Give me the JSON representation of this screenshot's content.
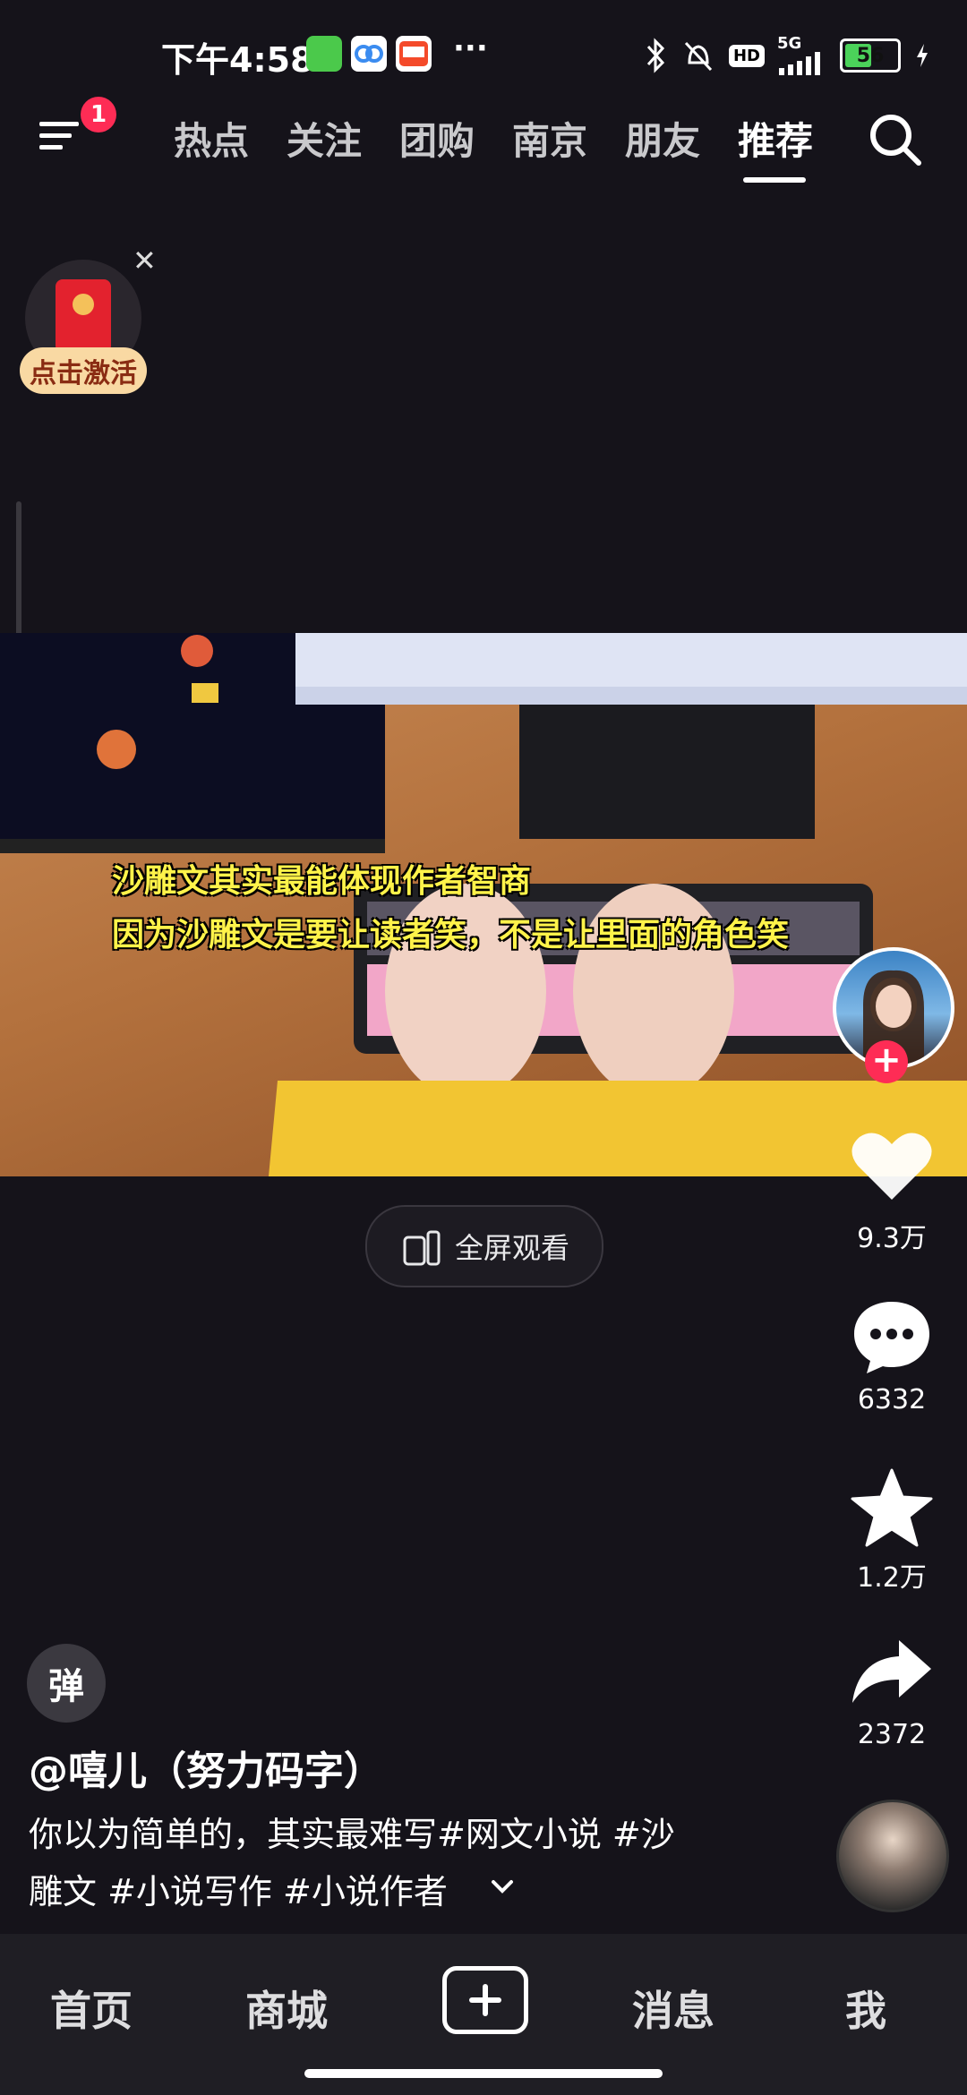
{
  "status_bar": {
    "time": "下午4:58",
    "network": "5G",
    "battery": "56",
    "battery_level": 0.56,
    "icons": [
      "app-green-icon",
      "app-blue-icon",
      "app-58-icon",
      "more-dots-icon",
      "bluetooth-icon",
      "mute-bell-icon",
      "hd-icon",
      "signal-icon",
      "charging-icon"
    ]
  },
  "top_nav": {
    "menu_badge": "1",
    "tabs": [
      "热点",
      "关注",
      "团购",
      "南京",
      "朋友",
      "推荐"
    ],
    "active_tab": "推荐"
  },
  "red_packet": {
    "label": "点击激活"
  },
  "video": {
    "subtitle_line1": "沙雕文其实最能体现作者智商",
    "subtitle_line2": "因为沙雕文是要让读者笑，不是让里面的角色笑",
    "fullscreen_label": "全屏观看"
  },
  "actions": {
    "likes": "9.3万",
    "comments": "6332",
    "favorites": "1.2万",
    "shares": "2372"
  },
  "post": {
    "danmu_label": "弹",
    "username": "@嘻儿（努力码字）",
    "desc_line1": "你以为简单的，其实最难写#网文小说 #沙",
    "desc_line2": "雕文 #小说写作 #小说作者"
  },
  "bottom_nav": {
    "home": "首页",
    "mall": "商城",
    "messages": "消息",
    "me": "我"
  },
  "colors": {
    "background": "#15131a",
    "accent_red": "#fe2c55",
    "subtitle_yellow": "#fff34a",
    "activate_bg": "#f9d9a3"
  }
}
